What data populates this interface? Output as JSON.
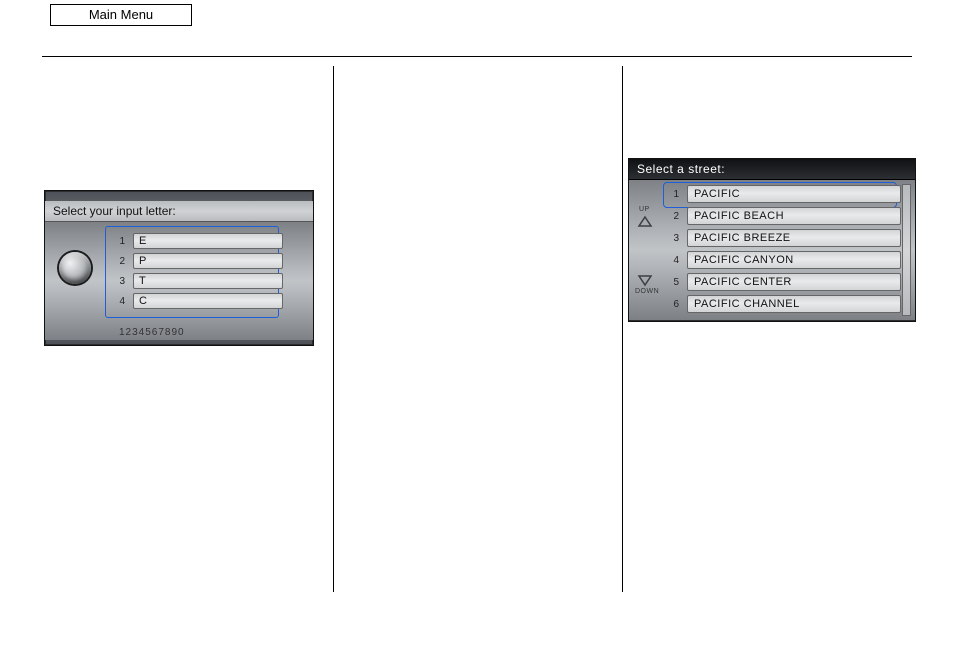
{
  "header": {
    "main_menu": "Main Menu"
  },
  "letter_panel": {
    "title": "Select your input letter:",
    "rows": [
      {
        "n": "1",
        "v": "E"
      },
      {
        "n": "2",
        "v": "P"
      },
      {
        "n": "3",
        "v": "T"
      },
      {
        "n": "4",
        "v": "C"
      }
    ],
    "numrow": "1234567890"
  },
  "street_panel": {
    "title": "Select a street:",
    "up_label": "UP",
    "down_label": "DOWN",
    "rows": [
      {
        "n": "1",
        "v": "PACIFIC"
      },
      {
        "n": "2",
        "v": "PACIFIC BEACH"
      },
      {
        "n": "3",
        "v": "PACIFIC BREEZE"
      },
      {
        "n": "4",
        "v": "PACIFIC CANYON"
      },
      {
        "n": "5",
        "v": "PACIFIC CENTER"
      },
      {
        "n": "6",
        "v": "PACIFIC CHANNEL"
      }
    ]
  }
}
